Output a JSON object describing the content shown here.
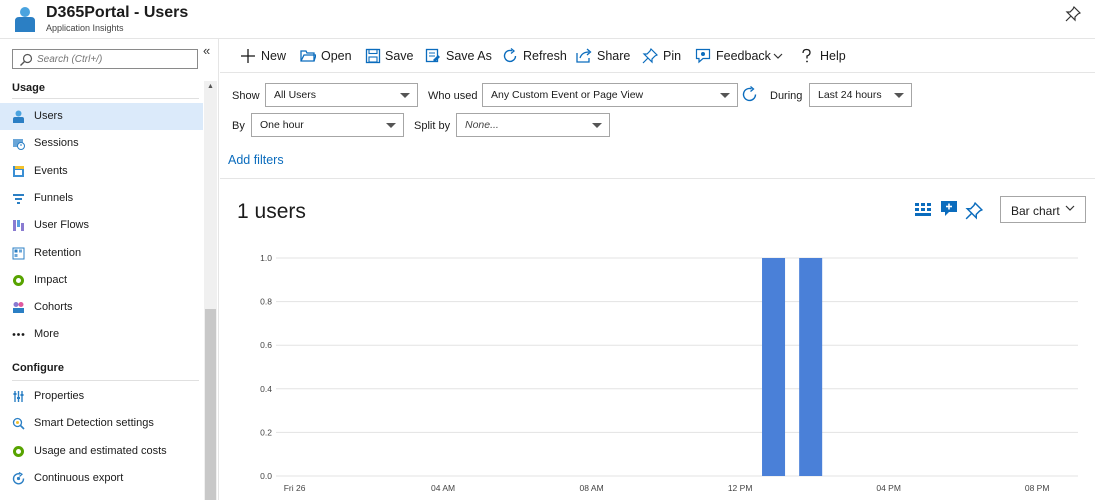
{
  "header": {
    "title": "D365Portal - Users",
    "subtitle": "Application Insights"
  },
  "sidebar": {
    "search_placeholder": "Search (Ctrl+/)",
    "collapse_glyph": "«",
    "usage_heading": "Usage",
    "configure_heading": "Configure",
    "usage_items": [
      {
        "label": "Users",
        "icon": "users-icon",
        "active": true
      },
      {
        "label": "Sessions",
        "icon": "sessions-icon"
      },
      {
        "label": "Events",
        "icon": "events-icon"
      },
      {
        "label": "Funnels",
        "icon": "funnels-icon"
      },
      {
        "label": "User Flows",
        "icon": "user-flows-icon"
      },
      {
        "label": "Retention",
        "icon": "retention-icon"
      },
      {
        "label": "Impact",
        "icon": "impact-icon"
      },
      {
        "label": "Cohorts",
        "icon": "cohorts-icon"
      },
      {
        "label": "More",
        "icon": "more-icon"
      }
    ],
    "configure_items": [
      {
        "label": "Properties",
        "icon": "properties-icon"
      },
      {
        "label": "Smart Detection settings",
        "icon": "smart-detection-icon"
      },
      {
        "label": "Usage and estimated costs",
        "icon": "usage-costs-icon"
      },
      {
        "label": "Continuous export",
        "icon": "continuous-export-icon"
      }
    ]
  },
  "toolbar": {
    "new": "New",
    "open": "Open",
    "save": "Save",
    "save_as": "Save As",
    "refresh": "Refresh",
    "share": "Share",
    "pin": "Pin",
    "feedback": "Feedback",
    "help": "Help"
  },
  "filters": {
    "show_label": "Show",
    "show_value": "All Users",
    "who_used_label": "Who used",
    "who_used_value": "Any Custom Event or Page View",
    "during_label": "During",
    "during_value": "Last 24 hours",
    "by_label": "By",
    "by_value": "One hour",
    "split_by_label": "Split by",
    "split_by_value": "None...",
    "add_filters": "Add filters"
  },
  "summary": {
    "users_count": "1 users",
    "chart_type_select": "Bar chart"
  },
  "colors": {
    "accent": "#0b6cbd",
    "bar": "#4a80d8",
    "active_nav": "#dbeafa"
  },
  "chart_data": {
    "type": "bar",
    "title": "",
    "xlabel": "",
    "ylabel": "",
    "ylim": [
      0,
      1
    ],
    "yticks": [
      "1.0",
      "0.8",
      "0.6",
      "0.4",
      "0.2",
      "0.0"
    ],
    "x_tick_labels": [
      "Fri 26",
      "04 AM",
      "08 AM",
      "12 PM",
      "04 PM",
      "08 PM"
    ],
    "x_hours": [
      0,
      4,
      8,
      12,
      16,
      20
    ],
    "x_range_hours": [
      -0.5,
      21.1
    ],
    "series": [
      {
        "bars": [
          {
            "hour": 12.9,
            "value": 1.0
          },
          {
            "hour": 13.9,
            "value": 1.0
          }
        ]
      }
    ]
  }
}
